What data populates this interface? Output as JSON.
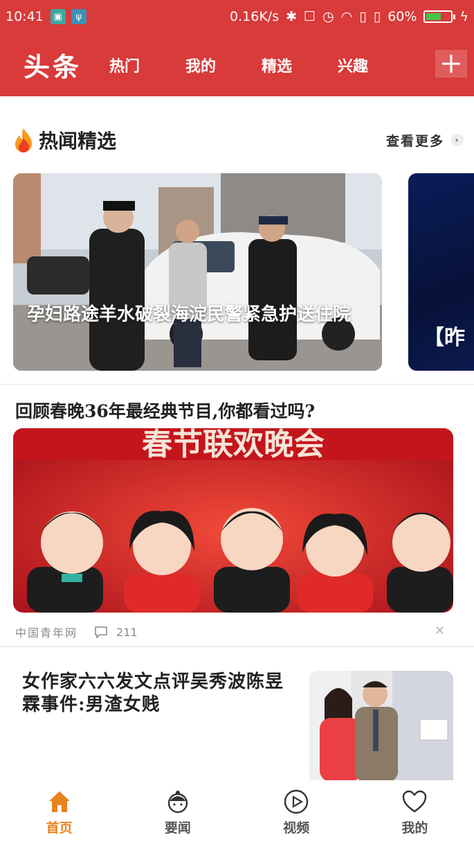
{
  "status_bar": {
    "time": "10:41",
    "net_speed": "0.16K/s",
    "battery_percent": "60%",
    "battery_level": 0.6
  },
  "header": {
    "logo": "头条",
    "tabs": [
      "热门",
      "我的",
      "精选",
      "兴趣"
    ]
  },
  "section": {
    "title": "热闻精选",
    "more_label": "查看更多"
  },
  "carousel": {
    "main_caption": "孕妇路途羊水破裂海淀民警紧急护送住院",
    "next_caption": "【昨"
  },
  "article1": {
    "title": "回顾春晚36年最经典节目,你都看过吗?",
    "source": "中国青年网",
    "comments": "211",
    "banner_text": "春节联欢晚会"
  },
  "article2": {
    "title": "女作家六六发文点评吴秀波陈昱霖事件:男渣女贱"
  },
  "bottom_nav": {
    "items": [
      "首页",
      "要闻",
      "视频",
      "我的"
    ],
    "active_color": "#e8821f"
  },
  "colors": {
    "brand_red": "#d93a3a",
    "accent_orange": "#e8821f"
  }
}
